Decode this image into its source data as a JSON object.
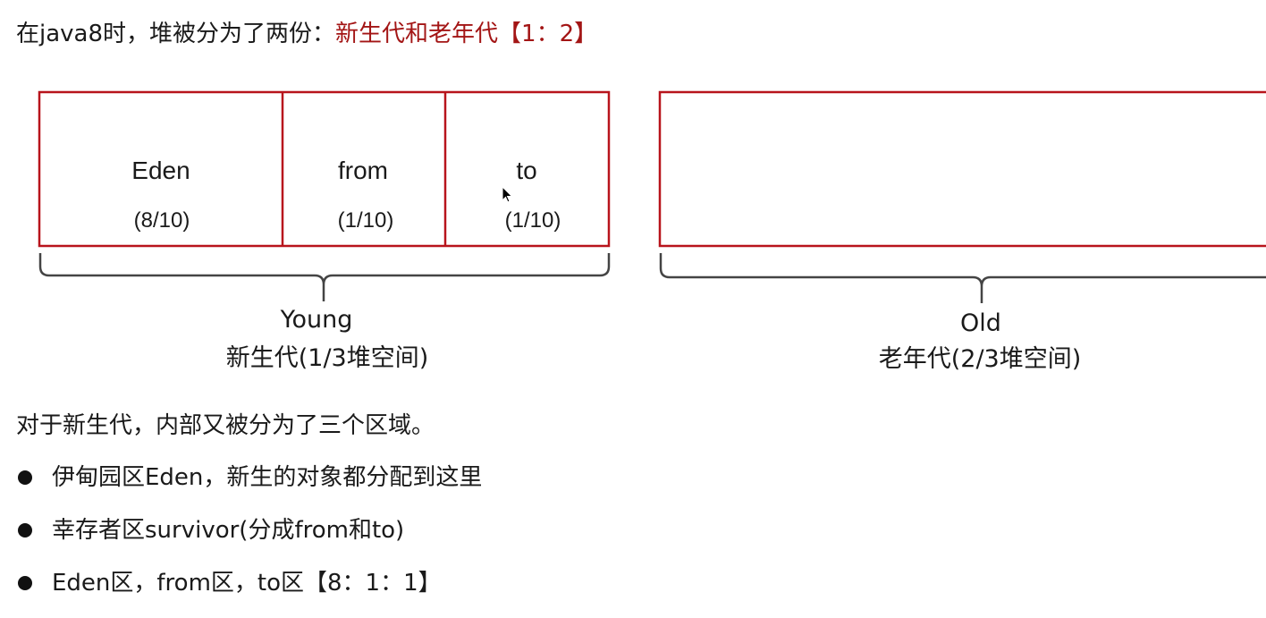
{
  "heading": {
    "prefix": "在java8时，堆被分为了两份：",
    "highlight": "新生代和老年代【1：2】"
  },
  "young_gen": {
    "cells": [
      {
        "name": "Eden",
        "ratio": "(8/10)"
      },
      {
        "name": "from",
        "ratio": "(1/10)"
      },
      {
        "name": "to",
        "ratio": "(1/10)"
      }
    ],
    "label_en": "Young",
    "label_zh": "新生代(1/3堆空间)"
  },
  "old_gen": {
    "label_en": "Old",
    "label_zh": "老年代(2/3堆空间)"
  },
  "description": "对于新生代，内部又被分为了三个区域。",
  "bullets": [
    "伊甸园区Eden，新生的对象都分配到这里",
    "幸存者区survivor(分成from和to)",
    "Eden区，from区，to区【8：1：1】"
  ],
  "colors": {
    "box_border": "#b8141c",
    "brace": "#444444",
    "accent_text": "#a31515"
  }
}
